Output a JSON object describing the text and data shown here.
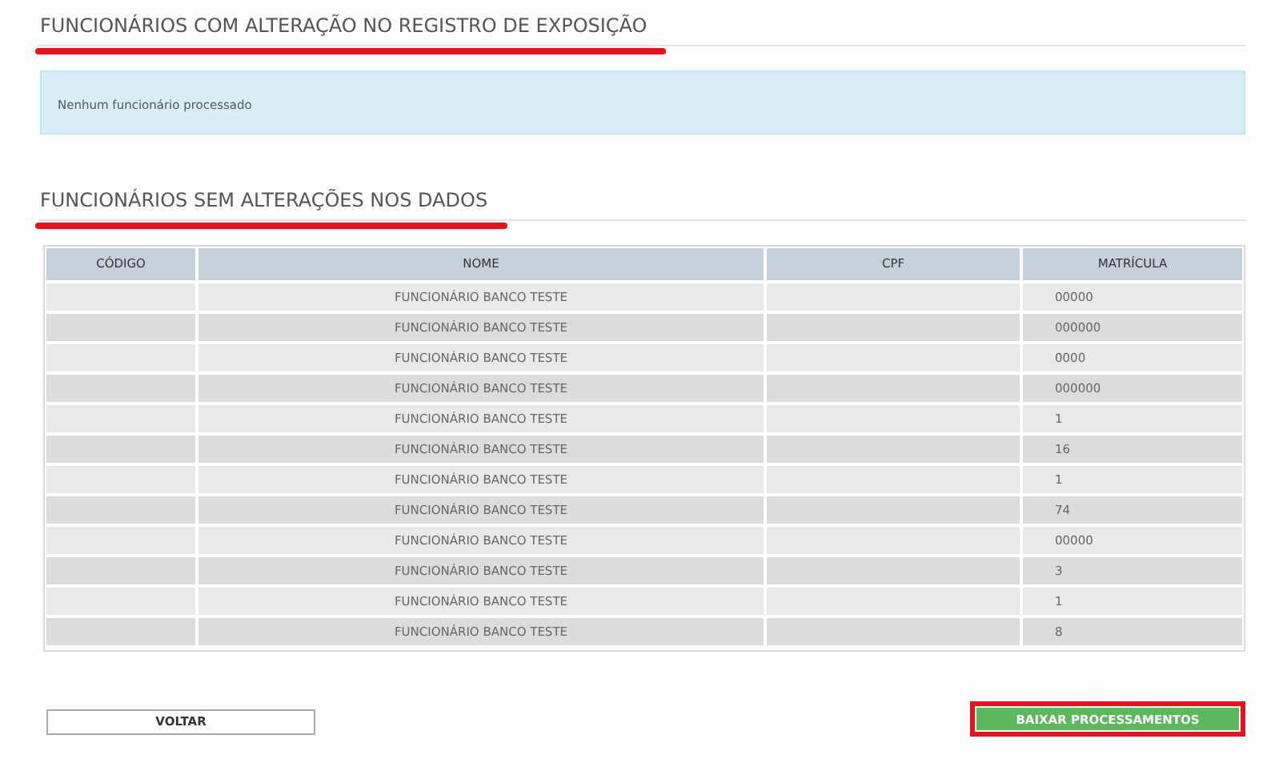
{
  "sections": [
    {
      "title": "FUNCIONÁRIOS COM ALTERAÇÃO NO REGISTRO DE EXPOSIÇÃO",
      "message": "Nenhum funcionário processado"
    },
    {
      "title": "FUNCIONÁRIOS SEM ALTERAÇÕES NOS DADOS",
      "table": {
        "columns": [
          "CÓDIGO",
          "NOME",
          "CPF",
          "MATRÍCULA"
        ],
        "rows": [
          [
            "",
            "FUNCIONÁRIO BANCO TESTE",
            "",
            "00000"
          ],
          [
            "",
            "FUNCIONÁRIO BANCO TESTE",
            "",
            "000000"
          ],
          [
            "",
            "FUNCIONÁRIO BANCO TESTE",
            "",
            "0000"
          ],
          [
            "",
            "FUNCIONÁRIO BANCO TESTE",
            "",
            "000000"
          ],
          [
            "",
            "FUNCIONÁRIO BANCO TESTE",
            "",
            "1"
          ],
          [
            "",
            "FUNCIONÁRIO BANCO TESTE",
            "",
            "16"
          ],
          [
            "",
            "FUNCIONÁRIO BANCO TESTE",
            "",
            "1"
          ],
          [
            "",
            "FUNCIONÁRIO BANCO TESTE",
            "",
            "74"
          ],
          [
            "",
            "FUNCIONÁRIO BANCO TESTE",
            "",
            "00000"
          ],
          [
            "",
            "FUNCIONÁRIO BANCO TESTE",
            "",
            "3"
          ],
          [
            "",
            "FUNCIONÁRIO BANCO TESTE",
            "",
            "1"
          ],
          [
            "",
            "FUNCIONÁRIO BANCO TESTE",
            "",
            "8"
          ]
        ]
      }
    }
  ],
  "buttons": [
    {
      "label": "VOLTAR",
      "kind": "secondary"
    },
    {
      "label": "BAIXAR PROCESSAMENTOS",
      "kind": "primary"
    }
  ]
}
